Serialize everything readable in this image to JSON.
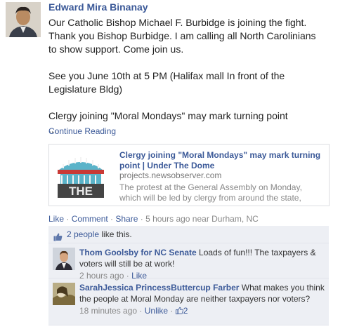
{
  "post": {
    "author": "Edward Mira Binanay",
    "body": "Our Catholic Bishop Michael F. Burbidge is joining the fight.\nThank you Bishop Burbidge. I am calling all North Carolinians\nto show support. Come join us.\n\nSee you June 10th at 5 PM (Halifax mall In front of the\nLegislature Bldg)\n\nClergy joining \"Moral Mondays\" may mark turning point\n...",
    "continue_label": "Continue Reading"
  },
  "share": {
    "title": "Clergy joining \"Moral Mondays\" may mark turning point | Under The Dome",
    "domain": "projects.newsobserver.com",
    "description": "The protest at the General Assembly on Monday, which will be led by clergy from around the state,"
  },
  "actions": {
    "like": "Like",
    "comment": "Comment",
    "share": "Share",
    "sep": " · ",
    "time": "5 hours ago near Durham, NC"
  },
  "likes": {
    "count_link": "2 people",
    "suffix": " like this."
  },
  "comments": [
    {
      "name": "Thom Goolsby for NC Senate",
      "text": " Loads of fun!!! The taxpayers & voters will still be at work!",
      "time": "2 hours ago",
      "like": "Like"
    },
    {
      "name": "SarahJessica PrincessButtercup Farber",
      "text": " What makes you think the people at Moral Monday are neither taxpayers nor voters?",
      "time": "18 minutes ago",
      "unlike": "Unlike",
      "like_count": "2"
    }
  ],
  "colors": {
    "link": "#3b5998",
    "ufi_bg": "#edeff4"
  }
}
